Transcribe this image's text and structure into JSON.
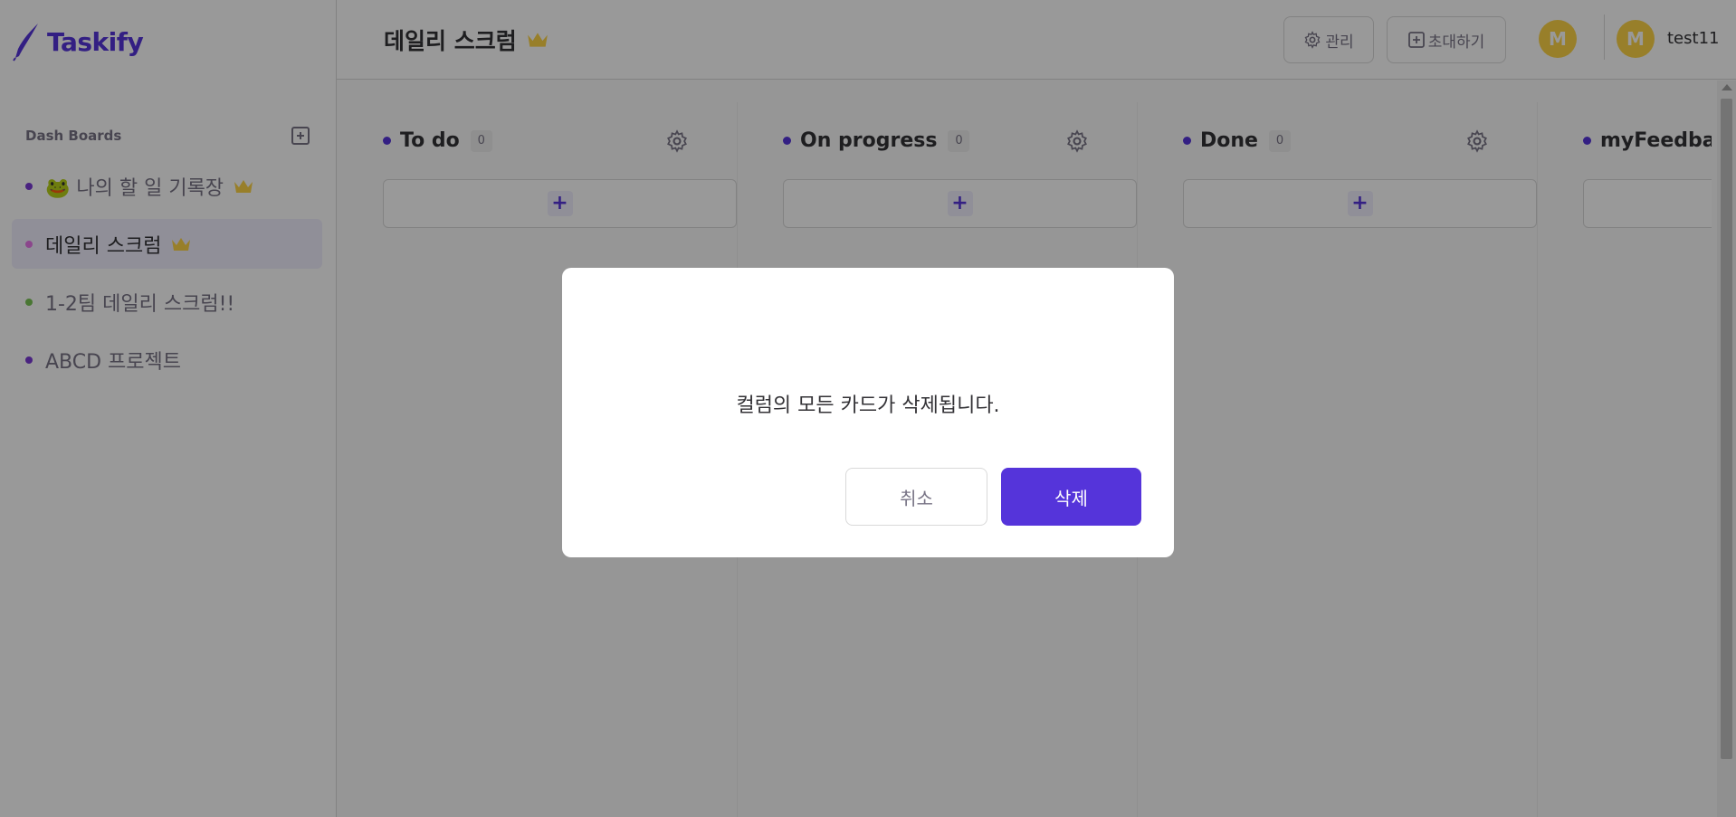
{
  "app": {
    "logo_text": "Taskify"
  },
  "sidebar": {
    "title": "Dash Boards",
    "items": [
      {
        "label": "🐸 나의 할 일 기록장",
        "dot_color": "#7a3ad6",
        "owner": true,
        "active": false
      },
      {
        "label": "데일리 스크럼",
        "dot_color": "#e876ea",
        "owner": true,
        "active": true
      },
      {
        "label": "1-2팀 데일리 스크럼!!",
        "dot_color": "#7ac555",
        "owner": false,
        "active": false
      },
      {
        "label": "ABCD 프로젝트",
        "dot_color": "#7a3ad6",
        "owner": false,
        "active": false
      }
    ]
  },
  "header": {
    "title": "데일리 스크럼",
    "manage_label": "관리",
    "invite_label": "초대하기",
    "member_avatar": "M",
    "user_avatar": "M",
    "username": "test11"
  },
  "columns": [
    {
      "title": "To do",
      "count": "0"
    },
    {
      "title": "On progress",
      "count": "0"
    },
    {
      "title": "Done",
      "count": "0"
    },
    {
      "title": "myFeedba",
      "count": ""
    }
  ],
  "modal": {
    "message": "컬럼의 모든 카드가 삭제됩니다.",
    "cancel_label": "취소",
    "delete_label": "삭제"
  },
  "colors": {
    "brand": "#5534da",
    "crown": "#fdd446",
    "avatar": "#fdd446"
  }
}
